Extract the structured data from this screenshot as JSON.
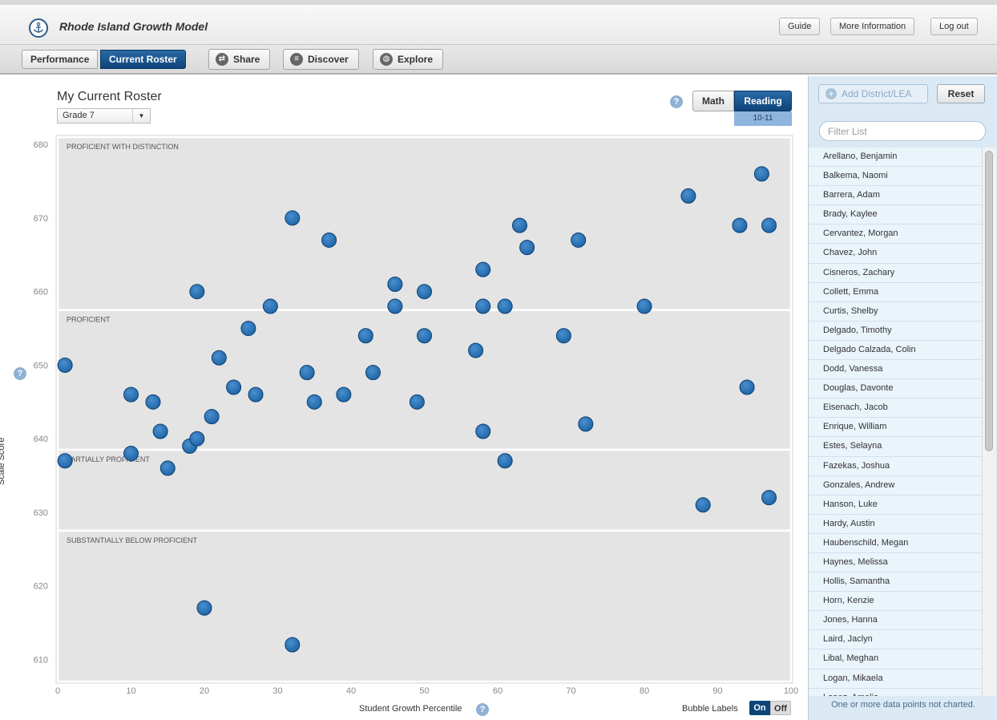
{
  "app": {
    "title": "Rhode Island Growth Model",
    "guide_label": "Guide",
    "more_info_label": "More Information",
    "logout_label": "Log out"
  },
  "nav": {
    "performance_label": "Performance",
    "current_roster_label": "Current Roster",
    "share_label": "Share",
    "discover_label": "Discover",
    "explore_label": "Explore",
    "icons": {
      "share": "share-icon",
      "discover": "list-icon",
      "explore": "globe-icon"
    }
  },
  "main": {
    "title": "My Current Roster",
    "grade_value": "Grade 7",
    "subject_math": "Math",
    "subject_reading": "Reading",
    "year": "10-11",
    "bubble_labels": "Bubble Labels",
    "toggle_on": "On",
    "toggle_off": "Off"
  },
  "chart_data": {
    "type": "scatter",
    "xlabel": "Student Growth Percentile",
    "ylabel": "Scale Score",
    "xlim": [
      0,
      100
    ],
    "ylim": [
      607,
      681
    ],
    "x_ticks": [
      0,
      10,
      20,
      30,
      40,
      50,
      60,
      70,
      80,
      90,
      100
    ],
    "y_ticks": [
      610,
      620,
      630,
      640,
      650,
      660,
      670,
      680
    ],
    "grid": false,
    "bands": [
      {
        "label": "PROFICIENT WITH DISTINCTION",
        "from": 657.5,
        "to": 681
      },
      {
        "label": "PROFICIENT",
        "from": 638.5,
        "to": 657.5
      },
      {
        "label": "PARTIALLY PROFICIENT",
        "from": 627.5,
        "to": 638.5
      },
      {
        "label": "SUBSTANTIALLY BELOW PROFICIENT",
        "from": 607,
        "to": 627.5
      }
    ],
    "point_color": "#1f67a8",
    "points": [
      [
        1,
        650
      ],
      [
        1,
        637
      ],
      [
        10,
        646
      ],
      [
        10,
        638
      ],
      [
        13,
        645
      ],
      [
        14,
        641
      ],
      [
        15,
        636
      ],
      [
        18,
        639
      ],
      [
        19,
        640
      ],
      [
        19,
        660
      ],
      [
        20,
        617
      ],
      [
        21,
        643
      ],
      [
        22,
        651
      ],
      [
        24,
        647
      ],
      [
        26,
        655
      ],
      [
        27,
        646
      ],
      [
        29,
        658
      ],
      [
        32,
        670
      ],
      [
        32,
        612
      ],
      [
        34,
        649
      ],
      [
        35,
        645
      ],
      [
        37,
        667
      ],
      [
        39,
        646
      ],
      [
        42,
        654
      ],
      [
        43,
        649
      ],
      [
        46,
        661
      ],
      [
        46,
        658
      ],
      [
        49,
        645
      ],
      [
        50,
        660
      ],
      [
        50,
        654
      ],
      [
        57,
        652
      ],
      [
        58,
        663
      ],
      [
        58,
        658
      ],
      [
        58,
        641
      ],
      [
        61,
        658
      ],
      [
        61,
        637
      ],
      [
        63,
        669
      ],
      [
        64,
        666
      ],
      [
        69,
        654
      ],
      [
        71,
        667
      ],
      [
        72,
        642
      ],
      [
        80,
        658
      ],
      [
        86,
        673
      ],
      [
        88,
        631
      ],
      [
        93,
        669
      ],
      [
        94,
        647
      ],
      [
        96,
        676
      ],
      [
        97,
        669
      ],
      [
        97,
        632
      ]
    ]
  },
  "sidebar": {
    "add_district_label": "Add District/LEA",
    "reset_label": "Reset",
    "filter_placeholder": "Filter List",
    "students": [
      "Arellano, Benjamin",
      "Balkema, Naomi",
      "Barrera, Adam",
      "Brady, Kaylee",
      "Cervantez, Morgan",
      "Chavez, John",
      "Cisneros, Zachary",
      "Collett, Emma",
      "Curtis, Shelby",
      "Delgado, Timothy",
      "Delgado Calzada, Colin",
      "Dodd, Vanessa",
      "Douglas, Davonte",
      "Eisenach, Jacob",
      "Enrique, William",
      "Estes, Selayna",
      "Fazekas, Joshua",
      "Gonzales, Andrew",
      "Hanson, Luke",
      "Hardy, Austin",
      "Haubenschild, Megan",
      "Haynes, Melissa",
      "Hollis, Samantha",
      "Horn, Kenzie",
      "Jones, Hanna",
      "Laird, Jaclyn",
      "Libal, Meghan",
      "Logan, Mikaela",
      "Lopez, Amelia"
    ],
    "footer_note": "One or more data points not charted."
  }
}
